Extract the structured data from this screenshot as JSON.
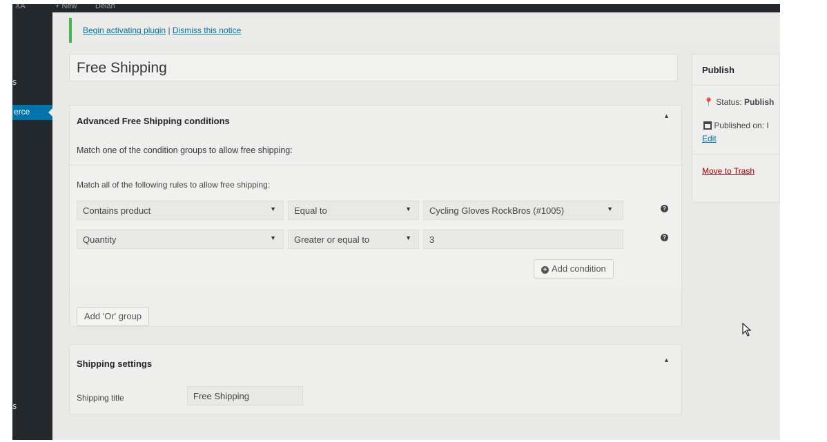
{
  "topbar": {
    "left_label": "XA",
    "new_label": "+ New",
    "right_label": "Delan"
  },
  "adminmenu": {
    "items": [
      {
        "label": "s"
      },
      {
        "label": "erce"
      },
      {
        "label": "s"
      }
    ]
  },
  "notice": {
    "activate_link": "Begin activating plugin",
    "separator": "|",
    "dismiss_link": "Dismiss this notice"
  },
  "post_title": "Free Shipping",
  "conditions": {
    "heading": "Advanced Free Shipping conditions",
    "intro": "Match one of the condition groups to allow free shipping:",
    "group_intro": "Match all of the following rules to allow free shipping:",
    "rules": [
      {
        "condition": "Contains product",
        "operator": "Equal to",
        "value": "Cycling Gloves RockBros (#1005)"
      },
      {
        "condition": "Quantity",
        "operator": "Greater or equal to",
        "value": "3"
      }
    ],
    "add_condition_label": "Add condition",
    "add_or_group_label": "Add 'Or' group"
  },
  "shipping_settings": {
    "heading": "Shipping settings",
    "title_label": "Shipping title",
    "title_value": "Free Shipping"
  },
  "publish": {
    "heading": "Publish",
    "status_label": "Status:",
    "status_value": "Publish",
    "published_label": "Published on:",
    "published_value": "I",
    "edit_link": "Edit",
    "trash_link": "Move to Trash"
  },
  "icons": {
    "pin": "pin-icon",
    "calendar": "calendar-icon",
    "help": "help-icon",
    "plus": "plus-circle-icon",
    "caret": "caret-down-icon",
    "toggle": "toggle-up-icon",
    "cursor": "mouse-pointer-icon"
  },
  "colors": {
    "link": "#0073aa",
    "trash": "#aa0000",
    "notice_border": "#46b450",
    "adminbar": "#23282d",
    "menu_current": "#0073aa"
  }
}
